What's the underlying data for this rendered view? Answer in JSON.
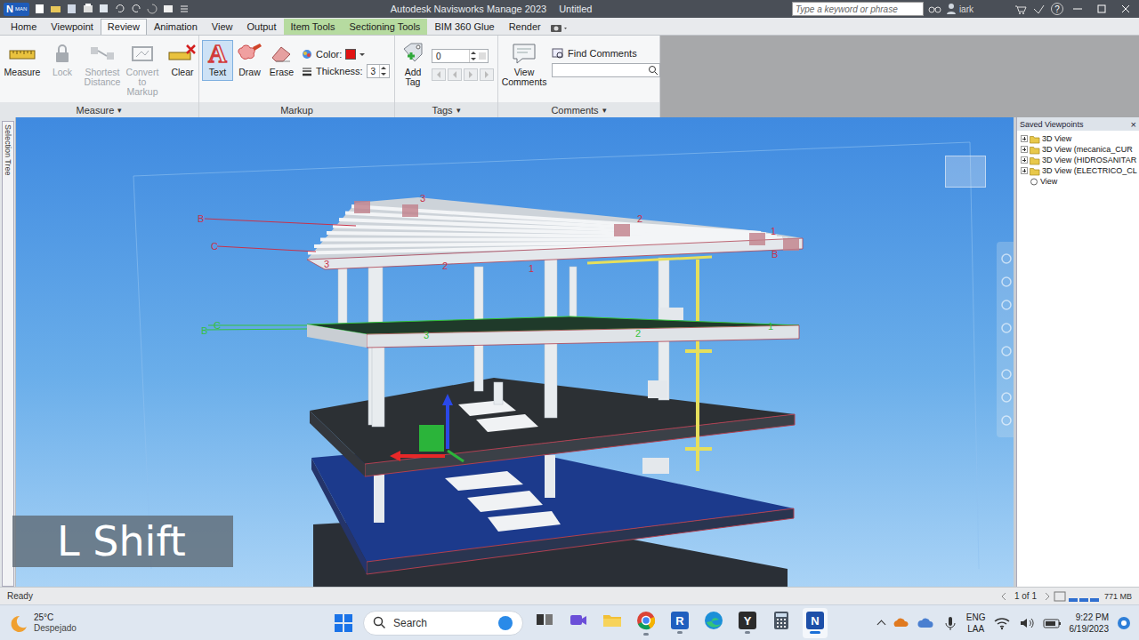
{
  "window": {
    "badge": "N",
    "badge_sub": "MAN",
    "title": "Autodesk Navisworks Manage 2023",
    "document": "Untitled",
    "search_placeholder": "Type a keyword or phrase",
    "user": "iark",
    "help": "?"
  },
  "tabs": [
    {
      "label": "Home",
      "selected": false,
      "kind": "normal"
    },
    {
      "label": "Viewpoint",
      "selected": false,
      "kind": "normal"
    },
    {
      "label": "Review",
      "selected": true,
      "kind": "normal"
    },
    {
      "label": "Animation",
      "selected": false,
      "kind": "normal"
    },
    {
      "label": "View",
      "selected": false,
      "kind": "normal"
    },
    {
      "label": "Output",
      "selected": false,
      "kind": "normal"
    },
    {
      "label": "Item Tools",
      "selected": false,
      "kind": "contextual"
    },
    {
      "label": "Sectioning Tools",
      "selected": false,
      "kind": "contextual"
    },
    {
      "label": "BIM 360 Glue",
      "selected": false,
      "kind": "normal"
    },
    {
      "label": "Render",
      "selected": false,
      "kind": "normal"
    }
  ],
  "ribbon": {
    "measure": {
      "label": "Measure",
      "arrow": "▾",
      "buttons": [
        {
          "label": "Measure",
          "disabled": false
        },
        {
          "label": "Lock",
          "disabled": true
        },
        {
          "label": "Shortest Distance",
          "disabled": true
        },
        {
          "label": "Convert to Markup",
          "disabled": true
        },
        {
          "label": "Clear",
          "disabled": false
        }
      ]
    },
    "markup": {
      "label": "Markup",
      "buttons": [
        {
          "label": "Text",
          "icon": "A",
          "selected": true
        },
        {
          "label": "Draw",
          "selected": false
        },
        {
          "label": "Erase",
          "selected": false
        }
      ],
      "color_label": "Color:",
      "color": "#e01414",
      "thickness_label": "Thickness:",
      "thickness": "3"
    },
    "tags": {
      "label": "Tags",
      "arrow": "▾",
      "add": "Add Tag",
      "value": "0"
    },
    "comments": {
      "label": "Comments",
      "arrow": "▾",
      "view": "View Comments",
      "find": "Find Comments"
    }
  },
  "selection_tree": {
    "label": "Selection Tree"
  },
  "viewport": {
    "caption": "L Shift",
    "grid_labels": [
      {
        "text": "B",
        "color": "#c8324a"
      },
      {
        "text": "C",
        "color": "#c8324a"
      },
      {
        "text": "3",
        "color": "#c8324a"
      },
      {
        "text": "2",
        "color": "#c8324a"
      },
      {
        "text": "1",
        "color": "#c8324a"
      },
      {
        "text": "3",
        "color": "#c8324a"
      },
      {
        "text": "2",
        "color": "#c8324a"
      },
      {
        "text": "1",
        "color": "#c8324a"
      },
      {
        "text": "B",
        "color": "#c8324a"
      },
      {
        "text": "B",
        "color": "#34c23c"
      },
      {
        "text": "C",
        "color": "#34c23c"
      },
      {
        "text": "3",
        "color": "#34c23c"
      },
      {
        "text": "2",
        "color": "#34c23c"
      },
      {
        "text": "1",
        "color": "#34c23c"
      }
    ]
  },
  "saved_viewpoints": {
    "title": "Saved Viewpoints",
    "close": "×",
    "items": [
      {
        "label": "3D View",
        "kind": "folder",
        "expanded": false
      },
      {
        "label": "3D View (mecanica_CUR",
        "kind": "folder",
        "expanded": false
      },
      {
        "label": "3D View (HIDROSANITAR",
        "kind": "folder",
        "expanded": false
      },
      {
        "label": "3D View (ELECTRICO_CL",
        "kind": "folder",
        "expanded": false
      },
      {
        "label": "View",
        "kind": "view",
        "expanded": false
      }
    ]
  },
  "status_bar": {
    "text": "Ready",
    "page": "1 of 1",
    "memory": "771 MB"
  },
  "taskbar": {
    "temp": "25°C",
    "condition": "Despejado",
    "search": "Search",
    "apps": [
      {
        "kind": "taskview",
        "running": false,
        "selected": false
      },
      {
        "kind": "meet",
        "running": false,
        "selected": false
      },
      {
        "kind": "folder",
        "running": false,
        "selected": false
      },
      {
        "kind": "chrome",
        "running": true,
        "selected": false
      },
      {
        "kind": "letter",
        "glyph": "R",
        "color": "#1f5fbf",
        "running": true,
        "selected": false
      },
      {
        "kind": "edge",
        "running": false,
        "selected": false
      },
      {
        "kind": "letter",
        "glyph": "Y",
        "color": "#2b2b2b",
        "running": true,
        "selected": false
      },
      {
        "kind": "calc",
        "running": false,
        "selected": false
      },
      {
        "kind": "letter",
        "glyph": "N",
        "color": "#1d4fa8",
        "running": true,
        "selected": true
      }
    ],
    "lang": "ENG",
    "layout": "LAA",
    "time": "9:22 PM",
    "date": "6/19/2023"
  }
}
